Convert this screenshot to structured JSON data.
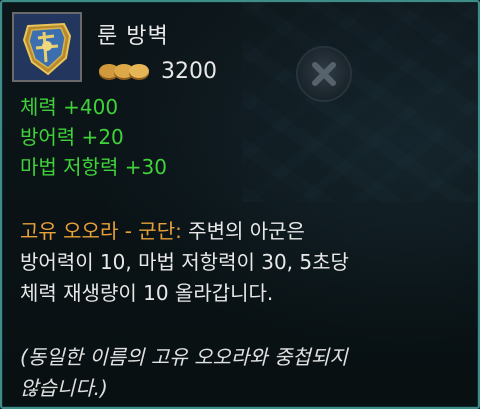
{
  "item": {
    "name": "룬 방벽",
    "cost": "3200",
    "icon": "rune-shield-icon",
    "currency_icon": "gold-coins-icon"
  },
  "stats": [
    "체력 +400",
    "방어력 +20",
    "마법 저항력 +30"
  ],
  "aura": {
    "name": "고유 오오라 - 군단:",
    "line1": " 주변의 아군은",
    "line2": "방어력이 10, 마법 저항력이 30, 5초당",
    "line3": "체력 재생량이 10 올라갑니다."
  },
  "note": {
    "line1": "(동일한 이름의 고유 오오라와 중첩되지",
    "line2": "않습니다.)"
  },
  "colors": {
    "border": "#3f8c88",
    "stat_green": "#3fd23a",
    "aura_orange": "#e8a038",
    "text": "#e8e8e8"
  }
}
